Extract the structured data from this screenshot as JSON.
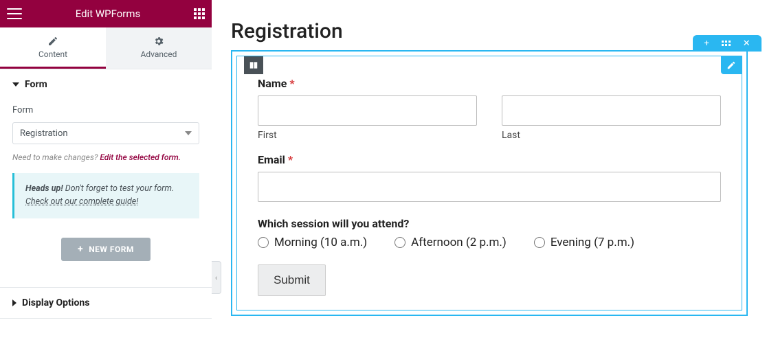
{
  "panel": {
    "title": "Edit WPForms",
    "tabs": {
      "content": "Content",
      "advanced": "Advanced"
    },
    "section_form": {
      "heading": "Form",
      "field_label": "Form",
      "selected": "Registration",
      "hint_prefix": "Need to make changes? ",
      "hint_link": "Edit the selected form.",
      "notice_bold": "Heads up!",
      "notice_text": " Don't forget to test your form. ",
      "notice_link": "Check out our complete guide!",
      "new_form_btn": "NEW FORM"
    },
    "section_display": {
      "heading": "Display Options"
    }
  },
  "preview": {
    "title": "Registration",
    "form": {
      "name_label": "Name",
      "first_sublabel": "First",
      "last_sublabel": "Last",
      "email_label": "Email",
      "session_label": "Which session will you attend?",
      "options": {
        "morning": "Morning (10 a.m.)",
        "afternoon": "Afternoon (2 p.m.)",
        "evening": "Evening (7 p.m.)"
      },
      "submit": "Submit"
    }
  }
}
